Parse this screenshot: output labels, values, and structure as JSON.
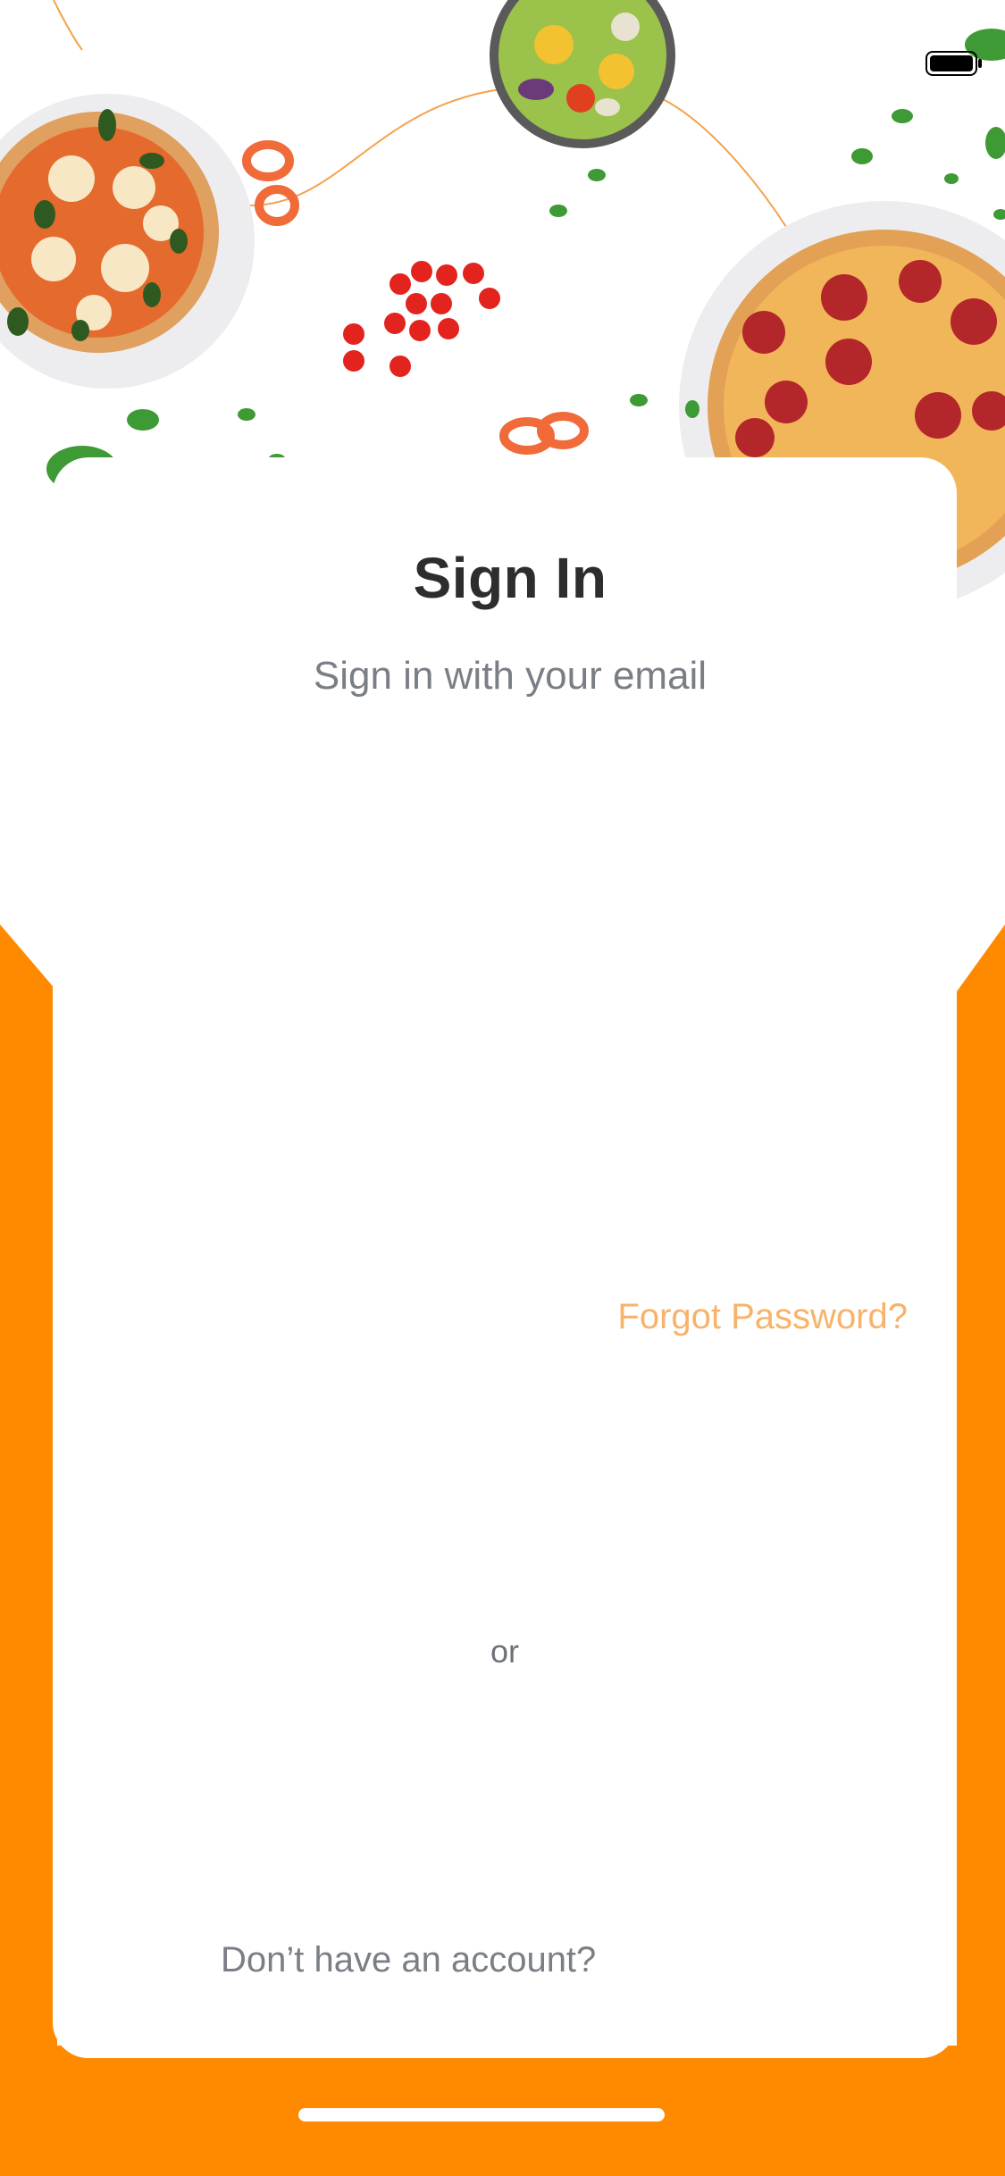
{
  "screen": {
    "title": "Sign In",
    "subtitle": "Sign in with your email",
    "forgot_password_label": "Forgot Password?",
    "divider_label": "or",
    "no_account_label": "Don’t have an account?"
  },
  "status_bar": {
    "battery_icon": "battery-full-icon"
  },
  "hero": {
    "items": [
      "margherita-pizza",
      "salad-bowl",
      "pepperoni-pizza",
      "cherry-tomatoes",
      "red-pepper-rings",
      "basil-leaves"
    ]
  },
  "colors": {
    "brand_orange": "#FF8A00",
    "forgot_text": "#F7B36A",
    "title_text": "#2D2D2F",
    "muted_text": "#7A7E85"
  }
}
